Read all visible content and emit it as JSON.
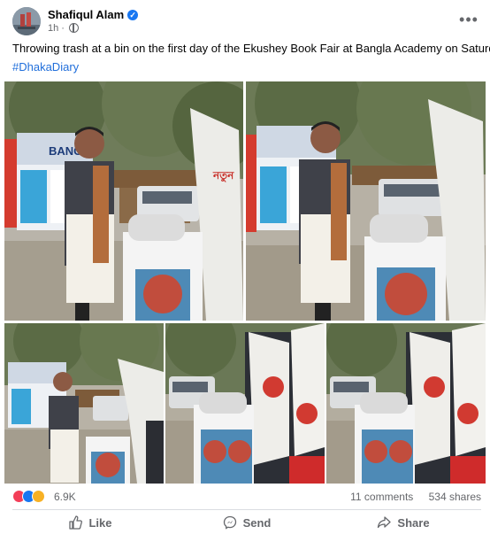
{
  "post": {
    "author": "Shafiqul Alam",
    "time": "1h",
    "caption": "Throwing trash at a bin on the first day of the Ekushey Book Fair at Bangla Academy on Saturday.",
    "hashtag": "#DhakaDiary"
  },
  "photos": {
    "stall_sign": "BANGLA",
    "book_sign": "নতুন"
  },
  "engagement": {
    "reaction_count": "6.9K",
    "comments": "11 comments",
    "shares": "534 shares"
  },
  "actions": {
    "like": "Like",
    "send": "Send",
    "share": "Share"
  },
  "colors": {
    "link": "#216fdb",
    "like_blue": "#1877f2",
    "love_red": "#f33e58",
    "haha_yellow": "#f7b125",
    "muted_text": "#65676b"
  }
}
